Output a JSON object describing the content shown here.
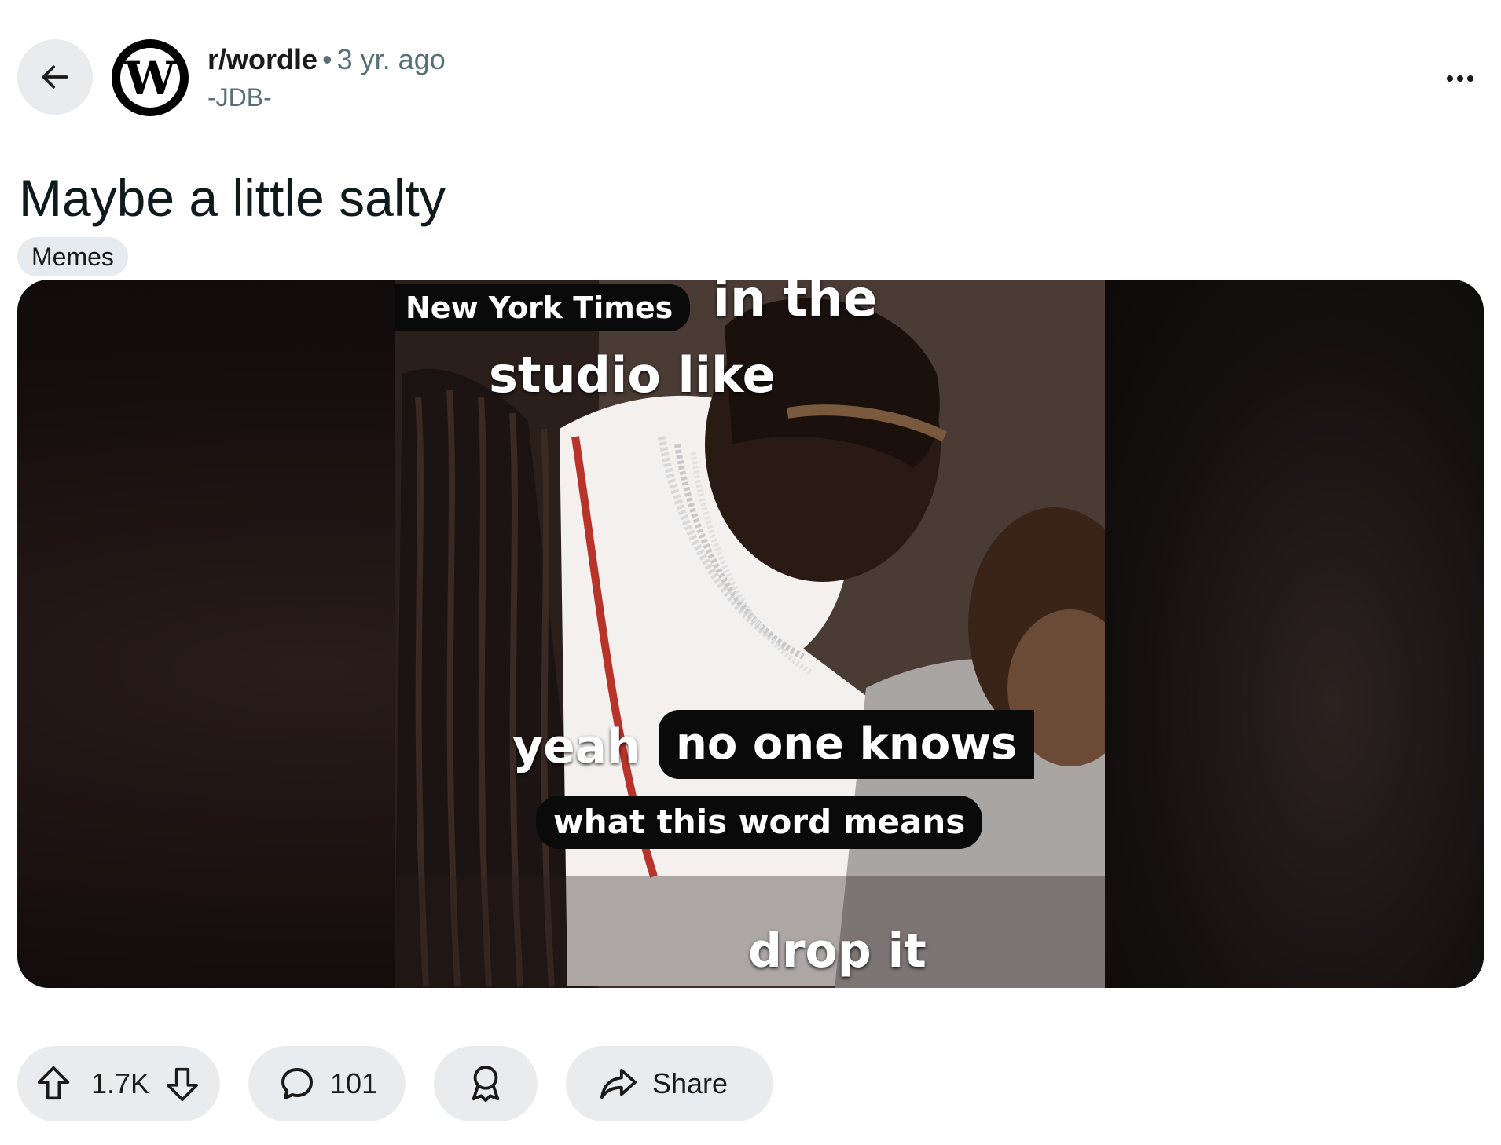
{
  "header": {
    "subreddit": "r/wordle",
    "separator": "•",
    "time_ago": "3 yr. ago",
    "author": "-JDB-",
    "avatar_letter": "W"
  },
  "post": {
    "title": "Maybe a little salty",
    "flair": "Memes"
  },
  "media": {
    "captions": {
      "nyt": "New York Times",
      "in_the": "in the",
      "studio_like": "studio like",
      "yeah": "yeah",
      "no_one_knows": "no one knows",
      "what_this_word_means": "what this word means",
      "drop_it": "drop it"
    }
  },
  "actions": {
    "upvote_count": "1.7K",
    "comment_count": "101",
    "share_label": "Share"
  },
  "icons": {
    "back": "arrow-left-icon",
    "more": "more-horizontal-icon",
    "upvote": "upvote-arrow-icon",
    "downvote": "downvote-arrow-icon",
    "comment": "comment-bubble-icon",
    "award": "award-ribbon-icon",
    "share": "share-arrow-icon"
  },
  "colors": {
    "pill_bg": "#e9ecef",
    "meta_gray": "#576f76",
    "flair_bg": "#e5ebee"
  }
}
